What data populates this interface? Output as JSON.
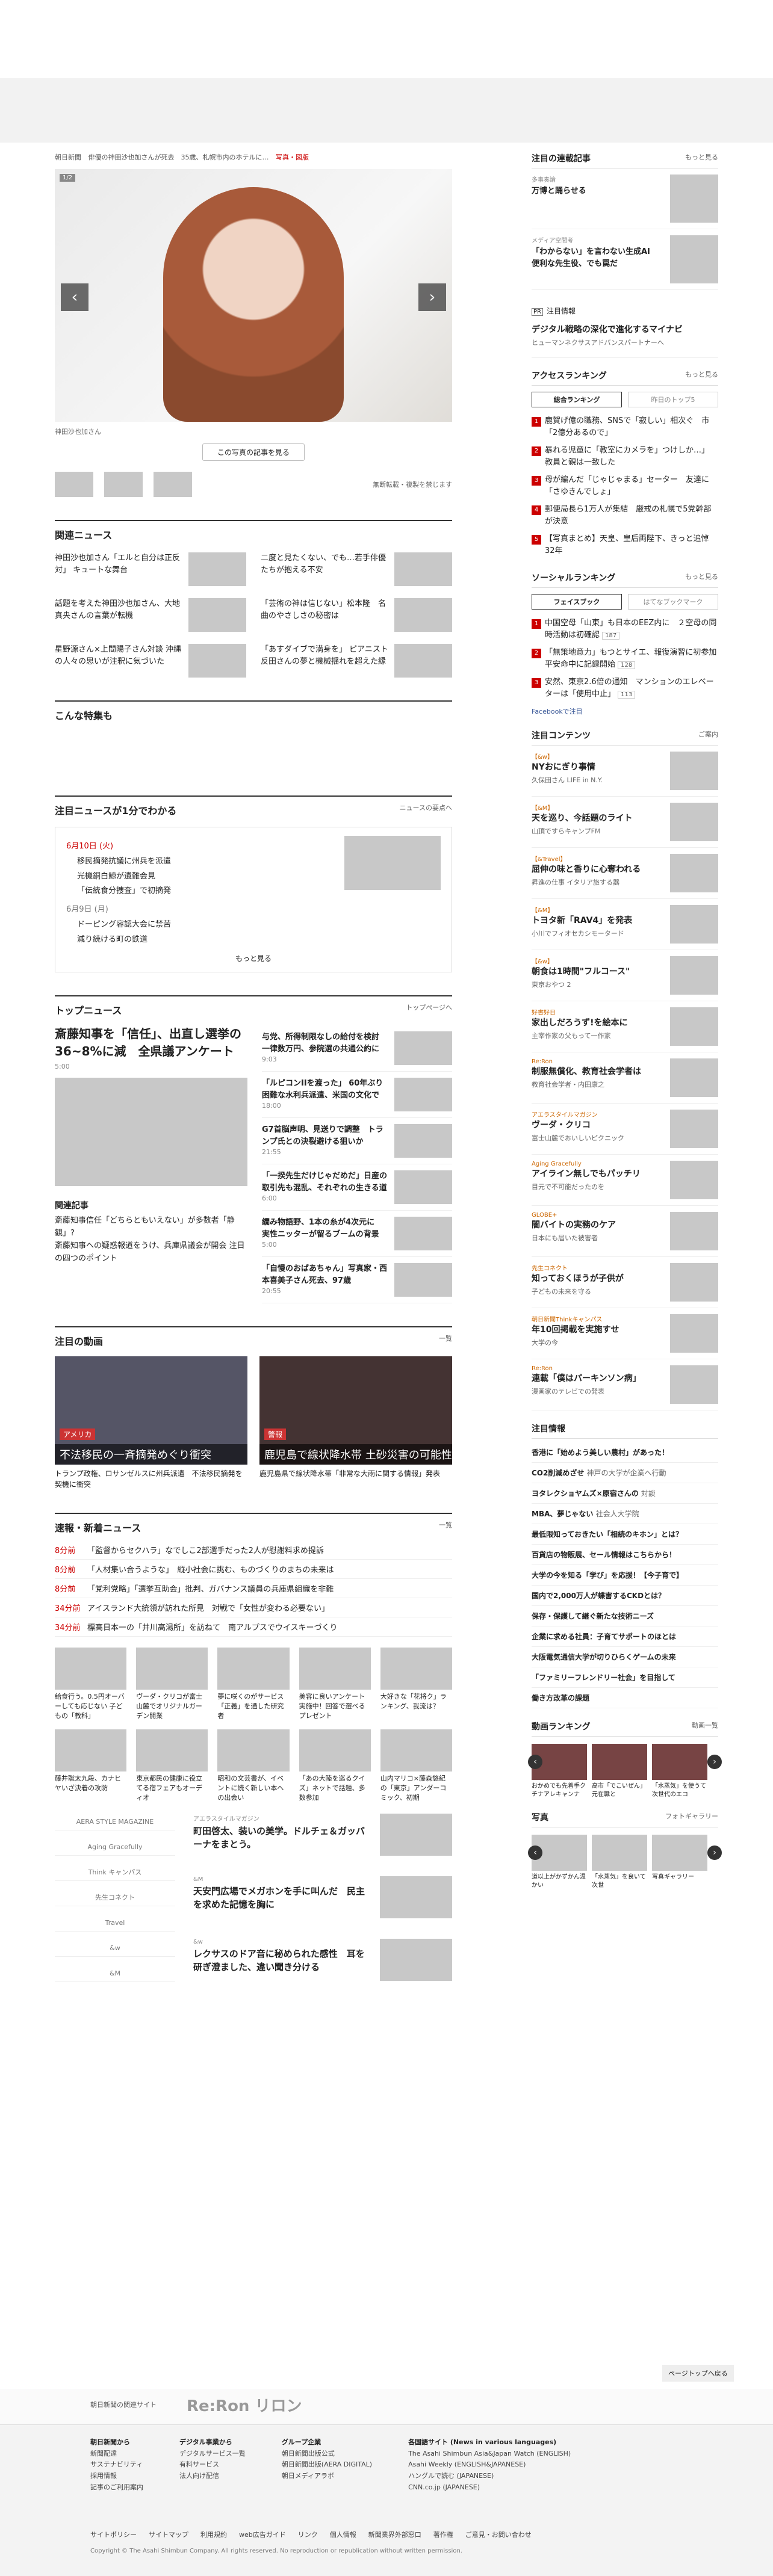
{
  "breadcrumb": [
    "朝日新聞",
    "俳優の神田沙也加さんが死去　35歳、札幌市内のホテルに…",
    "写真・図版"
  ],
  "hero": {
    "counter": "1/2",
    "caption": "神田沙也加さん",
    "button": "この写真の記事を見る",
    "note": "無断転載・複製を禁じます"
  },
  "related": {
    "title": "関連ニュース",
    "items": [
      "神田沙也加さん「エルと自分は正反対」 キュートな舞台",
      "二度と見たくない、でも…若手俳優たちが抱える不安",
      "話題を考えた神田沙也加さん、大地真央さんの言葉が転機",
      "「芸術の神は信じない」松本隆　名曲のやさしさの秘密は",
      "星野源さん×上間陽子さん対談 沖縄の人々の思いが注釈に気づいた",
      "「あすダイブで満身を」 ピアニスト反田さんの夢と機械揺れを超えた縁"
    ]
  },
  "special": {
    "title": "こんな特集も"
  },
  "onemin": {
    "title": "注目ニュースが1分でわかる",
    "more": "ニュースの要点へ",
    "d1": "6月10日 (火)",
    "d1items": [
      "移民摘発抗議に州兵を派遣",
      "光機銅白鯨が遺難会見",
      "「伝統食分捜査」で初摘発"
    ],
    "d2": "6月9日 (月)",
    "d2items": [
      "ドーピング容認大会に禁苦",
      "減り続ける町の鉄道"
    ],
    "more2": "もっと見る"
  },
  "topnews": {
    "title": "トップニュース",
    "more": "トップページへ",
    "lead": "斎藤知事を「信任」、出直し選挙の36~8%に減　全県議アンケート",
    "leadtime": "5:00",
    "sub": "関連記事",
    "subitems": [
      "斎藤知事信任「どちらともいえない」が多数者「静観」?",
      "斎藤知事への疑惑報道をうけ、兵庫県議会が開会 注目の四つのポイント"
    ],
    "items": [
      {
        "t": "与党、所得制限なしの給付を検討　一律数万円、参院選の共通公約に",
        "tm": "9:03"
      },
      {
        "t": "「ルピコンIIを渡った」 60年ぶり困難な水利兵派遣、米国の文化で",
        "tm": "18:00"
      },
      {
        "t": "G7首脳声明、見送りで調整　トランプ氏との決裂避ける狙いか",
        "tm": "21:55"
      },
      {
        "t": "「一揆先生だけじゃだめだ」日産の取引先も混乱、それぞれの生きる道",
        "tm": "6:00"
      },
      {
        "t": "繝み物語野、1本の糸が4次元に　実性ニッターが留るブームの背景",
        "tm": "5:00"
      },
      {
        "t": "「自慢のおばあちゃん」写真家・西本喜美子さん死去、97歳",
        "tm": "20:55"
      }
    ]
  },
  "videos": {
    "title": "注目の動画",
    "more": "一覧",
    "items": [
      {
        "tag": "アメリカ",
        "caption": "不法移民の一斉摘発めぐり衝突",
        "text": "トランプ政権、ロサンゼルスに州兵派遣　不法移民摘発を契機に衝突"
      },
      {
        "tag": "警報",
        "caption": "鹿児島で線状降水帯 土砂災害の可能性",
        "text": "鹿児島県で線状降水帯「非常な大雨に関する情報」発表"
      }
    ]
  },
  "flash": {
    "title": "速報・新着ニュース",
    "more": "一覧",
    "items": [
      {
        "tm": "8分前",
        "t": "「監督からセクハラ」なでしこ2部選手だった2人が慰謝料求め提訴"
      },
      {
        "tm": "8分前",
        "t": "「人材集い合うような」　縦小社会に挑む、ものづくりのまちの未来は"
      },
      {
        "tm": "8分前",
        "t": "「党利党略」「選挙互助会」批判、ガバナンス議員の兵庫県組織を非難"
      },
      {
        "tm": "34分前",
        "t": "アイスランド大統領が訪れた所見　対戦で「女性が変わる必要ない」"
      },
      {
        "tm": "34分前",
        "t": "標高日本一の「井川高湯所」を訪ねて　南アルプスでウイスキーづくり"
      }
    ]
  },
  "grid": [
    "給食行う。0.5円オーバーしても応じない 子どもの「教科」",
    "ヴーダ・クリコが富士山麓でオリジナルガーデン開業",
    "夢に咲くのがサービス「正義」を通した研究者",
    "美容に良いアンケート実施中！回答で選べるプレゼント",
    "大好きな「花将ク」ランキング、我流は？",
    "藤井聡太九段、カナヒヤいざ決着の攻防",
    "東京都民の健康に役立てる宿フェアもオーディオ",
    "昭和の文芸書が、イベントに続く新しい本への出会い",
    "「あの大陸を巡るクイズ」ネットで話題、多数参加",
    "山内マリコ×藤森悠紀の「東京」アンダーコミック、初期"
  ],
  "mags": {
    "logos": [
      "AERA STYLE MAGAZINE",
      "Aging Gracefully",
      "Think キャンパス",
      "先生コネクト",
      "Travel",
      "&w",
      "&M"
    ],
    "items": [
      {
        "l": "アエラスタイルマガジン",
        "h": "町田啓太、装いの美学。ドルチェ＆ガッバーナをまとう。"
      },
      {
        "l": "&M",
        "h": "天安門広場でメガホンを手に叫んだ　民主を求めた記憶を胸に"
      },
      {
        "l": "&w",
        "h": "レクサスのドア音に秘められた感性　耳を研ぎ澄ました、違い聞き分ける"
      }
    ]
  },
  "side": {
    "serial": {
      "title": "注目の連載記事",
      "more": "もっと見る",
      "items": [
        {
          "l": "多事奏論",
          "h": "万博と踊らせる"
        },
        {
          "l": "メディア空間考",
          "h": "「わからない」を言わない生成AI　便利な先生役、でも罠だ"
        }
      ]
    },
    "ad": {
      "k": "PR",
      "t": "注目情報",
      "h": "デジタル戦略の深化で進化するマイナビ",
      "s": "ヒューマンネクサスアドバンスパートナーへ"
    },
    "rank": {
      "title": "アクセスランキング",
      "more": "もっと見る",
      "tab1": "総合ランキング",
      "tab2": "昨日のトップ5",
      "items": [
        {
          "t": "鹿賀げ億の職務、SNSで「寂しい」相次ぐ　市「2億分あるので」",
          "c": ""
        },
        {
          "t": "暴れる児童に「教室にカメラを」つけしか…」　教員と親は一致した",
          "c": ""
        },
        {
          "t": "母が編んだ「じゃじゃまる」セーター　友達に「さゆきんでしょ」",
          "c": ""
        },
        {
          "t": "郵便局長ら1万人が集結　厳戒の札幌で5党幹部が決意",
          "c": ""
        },
        {
          "t": "【写真まとめ】天皇、皇后両陛下、きっと追悼32年",
          "c": ""
        }
      ]
    },
    "social": {
      "title": "ソーシャルランキング",
      "more": "もっと見る",
      "tab1": "フェイスブック",
      "tab2": "はてなブックマーク",
      "items": [
        {
          "t": "中国空母「山東」も日本のEEZ内に　２空母の同時活動は初確認",
          "c": "187"
        },
        {
          "t": "「無策地意力」もつとサイエ、報復演習に初参加　平安命中に記録開始",
          "c": "128"
        },
        {
          "t": "安然、東京2.6倍の通知　マンションのエレベーターは「使用中止」",
          "c": "113"
        }
      ],
      "fb": "Facebookで注目"
    },
    "contents": {
      "title": "注目コンテンツ",
      "more": "ご案内",
      "items": [
        {
          "l": "【&w】",
          "h": "NYおにぎり事情",
          "s": "久保田さん LIFE in N.Y."
        },
        {
          "l": "【&M】",
          "h": "天を巡り、今話題のライト",
          "s": "山頂ですらキャンプFM"
        },
        {
          "l": "【&Travel】",
          "h": "屈伸の味と香りに心奪われる",
          "s": "昇進の仕事 イタリア旅する器"
        },
        {
          "l": "【&M】",
          "h": "トヨタ新「RAV4」を発表",
          "s": "小川でフィオセカシモータード"
        },
        {
          "l": "【&w】",
          "h": "朝食は1時間\"フルコース\"",
          "s": "東京おやつ 2"
        },
        {
          "l": "好書好日",
          "h": "家出しだろうず!を絵本に",
          "s": "主宰作家の父もって一作家"
        },
        {
          "l": "Re:Ron",
          "h": "制服無償化、教育社会学者は",
          "s": "教育社会学者・内田康之"
        },
        {
          "l": "アエラスタイルマガジン",
          "h": "ヴーダ・クリコ",
          "s": "富士山麓でおいしいピクニック"
        },
        {
          "l": "Aging Gracefully",
          "h": "アイライン無しでもパッチリ",
          "s": "目元で不可能だったのを"
        },
        {
          "l": "GLOBE+",
          "h": "闇バイトの実務のケア",
          "s": "日本にも届いた被害者"
        },
        {
          "l": "先生コネクト",
          "h": "知っておくほうが子供が",
          "s": "子どもの未来を守る"
        },
        {
          "l": "朝日新聞Thinkキャンパス",
          "h": "年10回掲載を実施すせ",
          "s": "大学の今"
        },
        {
          "l": "Re:Ron",
          "h": "連載「僕はパーキンソン病」",
          "s": "漫画家のテレビでの発表"
        }
      ]
    },
    "pr": {
      "title": "注目情報",
      "items": [
        {
          "h": "香港に「始めよう美しい農村」があった！",
          "s": ""
        },
        {
          "h": "CO2削減めざせ",
          "s": "神戸の大学が企業へ行動"
        },
        {
          "h": "ヨタレクショヤムズ×原宿さんの",
          "s": "対談"
        },
        {
          "h": "MBA、夢じゃない",
          "s": "社会人大学院"
        },
        {
          "h": "最低限知っておきたい「相続のキホン」とは？",
          "s": ""
        },
        {
          "h": "百貨店の物販展、セール情報はこちらから！",
          "s": ""
        },
        {
          "h": "大学の今を知る「学び」を応援！【今子育で】",
          "s": ""
        },
        {
          "h": "国内で2,000万人が蝶害するCKDとは？",
          "s": ""
        },
        {
          "h": "保存・保護して継ぐ新たな技術ニーズ",
          "s": ""
        },
        {
          "h": "企業に求める社員：子育てサポートのほとは",
          "s": ""
        },
        {
          "h": "大阪電気通信大学が切りひらくゲームの未来",
          "s": ""
        },
        {
          "h": "「ファミリーフレンドリー社会」を目指して",
          "s": ""
        },
        {
          "h": "働き方改革の課題",
          "s": ""
        }
      ]
    },
    "vrank": {
      "title": "動画ランキング",
      "more": "動画一覧",
      "items": [
        "おかめでも先着手クチナアレキャンナ",
        "高市「でこいぜん」 元在職と",
        "「水蒸気」を使うて次世代のエコ"
      ]
    },
    "photo": {
      "title": "写真",
      "more": "フォトギャラリー",
      "items": [
        "道以上がかずかん温かい",
        "「水蒸気」を良いて次世",
        "写真ギャラリー"
      ]
    }
  },
  "pagetop": "ページトップへ戻る",
  "footer": {
    "brand": "朝日新聞の関連サイト",
    "logo": "Re:Ron リロン",
    "cols": [
      {
        "h": "朝日新聞から",
        "items": [
          "新聞配達",
          "サステナビリティ",
          "採用情報",
          "記事のご利用案内"
        ]
      },
      {
        "h": "デジタル事業から",
        "items": [
          "デジタルサービス一覧",
          "有料サービス",
          "法人向け配信"
        ]
      },
      {
        "h": "グループ企業",
        "items": [
          "朝日新聞出版公式",
          "朝日新聞出版(AERA DIGITAL)",
          "朝日メディアラボ"
        ]
      },
      {
        "h": "各国語サイト (News in various languages)",
        "items": [
          "The Asahi Shimbun Asia&Japan Watch (ENGLISH)",
          "Asahi Weekly (ENGLISH&JAPANESE)",
          "ハングルで読む (JAPANESE)",
          "CNN.co.jp (JAPANESE)"
        ]
      }
    ],
    "links": [
      "サイトポリシー",
      "サイトマップ",
      "利用規約",
      "web広告ガイド",
      "リンク",
      "個人情報",
      "新聞業界外部窓口",
      "著作権",
      "ご意見・お問い合わせ"
    ],
    "copy": "Copyright © The Asahi Shimbun Company. All rights reserved. No reproduction or republication without written permission."
  }
}
